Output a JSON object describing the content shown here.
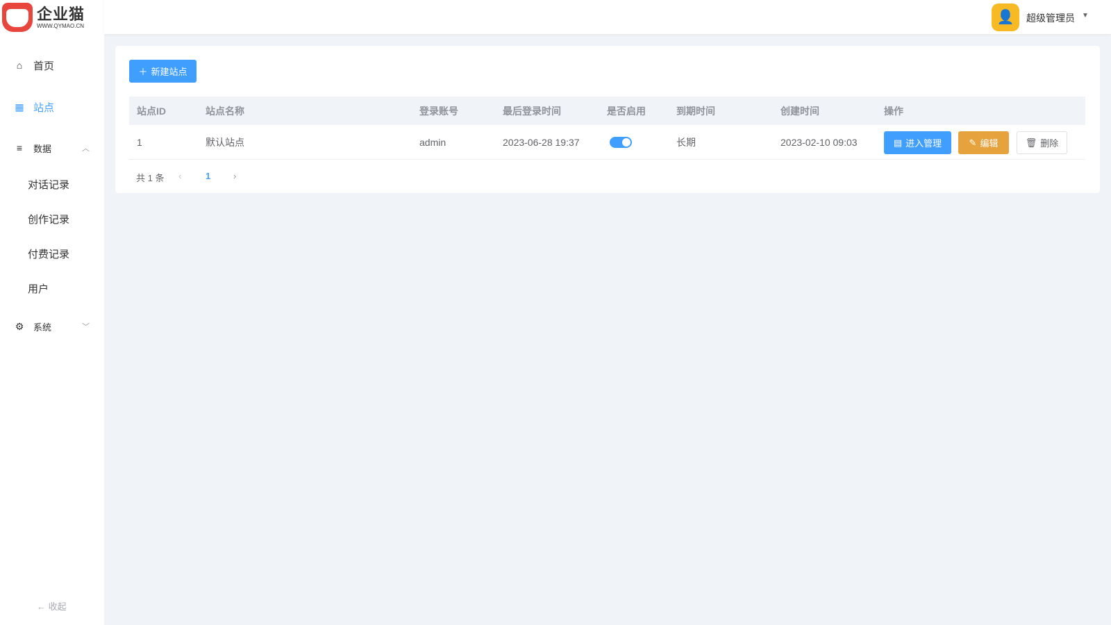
{
  "logo": {
    "name": "企业猫",
    "url": "WWW.QYMAO.CN"
  },
  "header": {
    "user": "超级管理员"
  },
  "sidebar": {
    "items": [
      {
        "label": "首页",
        "icon": "home-icon"
      },
      {
        "label": "站点",
        "icon": "grid-icon"
      },
      {
        "label": "数据",
        "icon": "menu-icon"
      },
      {
        "label": "对话记录"
      },
      {
        "label": "创作记录"
      },
      {
        "label": "付费记录"
      },
      {
        "label": "用户"
      },
      {
        "label": "系统",
        "icon": "gear-icon"
      }
    ],
    "collapse": "收起"
  },
  "toolbar": {
    "new_site": "新建站点"
  },
  "table": {
    "columns": [
      "站点ID",
      "站点名称",
      "登录账号",
      "最后登录时间",
      "是否启用",
      "到期时间",
      "创建时间",
      "操作"
    ],
    "rows": [
      {
        "id": "1",
        "name": "默认站点",
        "account": "admin",
        "last_login": "2023-06-28 19:37",
        "enabled": true,
        "expire": "长期",
        "created": "2023-02-10 09:03",
        "actions": {
          "manage": "进入管理",
          "edit": "编辑",
          "delete": "删除"
        }
      }
    ]
  },
  "pagination": {
    "total": "共 1 条",
    "current": "1"
  },
  "colors": {
    "primary": "#409eff",
    "warning": "#e6a23c",
    "avatar": "#f7b924"
  }
}
